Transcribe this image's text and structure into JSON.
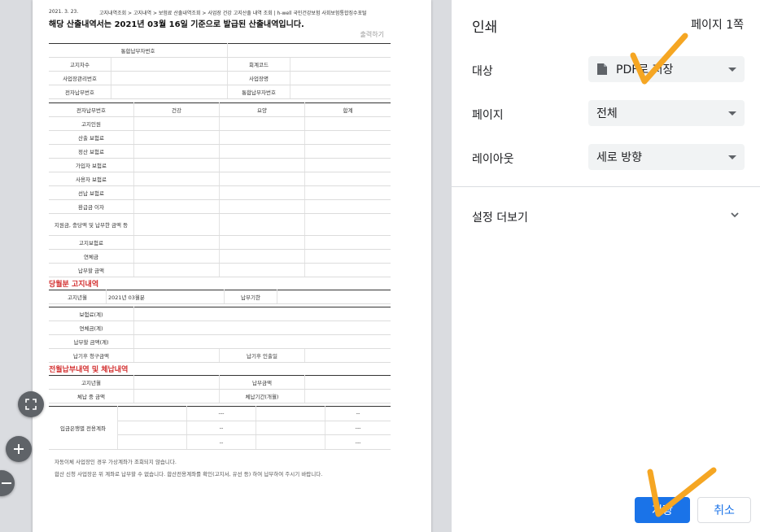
{
  "document": {
    "date": "2021. 3. 23.",
    "breadcrumb": "고지내역조회 > 고지내역 > 보험료 산출내역조회 > 사업장 건강 고지산출 내역 조회 | h-well 국민건강보험 사회보험통합징수포털",
    "headline": "해당 산출내역서는 2021년 03월 16일 기준으로 발급된 산출내역입니다.",
    "print_link": "출력하기",
    "info_rows": [
      [
        "통합납부자번호",
        "",
        "",
        ""
      ],
      [
        "고지차수",
        "",
        "회계코드",
        ""
      ],
      [
        "사업장관리번호",
        "",
        "사업장명",
        ""
      ],
      [
        "전자납부번호",
        "",
        "통합납부자번호",
        ""
      ]
    ],
    "calc_header": [
      "전자납부번호",
      "건강",
      "요양",
      "합계"
    ],
    "calc_rows": [
      "고지인원",
      "산출 보험료",
      "정산 보험료",
      "가입자 보험료",
      "사용자 보험료",
      "선납 보험료",
      "환급금 이자",
      "지원금, 충당액 및 납부한 금액 등",
      "고지보험료",
      "연체금",
      "납부할 금액"
    ],
    "section1_title": "당월분 고지내역",
    "section1": {
      "period_label": "고지년월",
      "period_value": "2021년 03월분",
      "due_label": "납부기한",
      "rows": [
        "보험료(계)",
        "연체금(계)",
        "납부할 금액(계)"
      ],
      "late_label": "납기후 청구금액",
      "late_date_label": "납기후 인출일"
    },
    "section2_title": "전월납부내역 및 체납내역",
    "section2": {
      "r1_left": "고지년월",
      "r1_right": "납부금액",
      "r2_left": "체납 중 금액",
      "r2_right": "체납기간(개월)"
    },
    "bank": {
      "label": "입금은행별 전용계좌",
      "dashes": [
        "---",
        "--",
        "--",
        "---",
        "--",
        "---"
      ]
    },
    "notes": [
      "자동이체 사업장인 경우 가상계좌가 조회되지 않습니다.",
      "합산 신청 사업장은 위 계좌로 납부할 수 없습니다. 합산전용계좌를 확인(고지서, 유선 등) 하여 납부하여 주시기 바랍니다."
    ]
  },
  "print_panel": {
    "title": "인쇄",
    "page_count": "페이지 1쪽",
    "destination_label": "대상",
    "destination_value": "PDF로 저장",
    "pages_label": "페이지",
    "pages_value": "전체",
    "layout_label": "레이아웃",
    "layout_value": "세로 방향",
    "more_settings": "설정 더보기",
    "save_button": "저장",
    "cancel_button": "취소"
  },
  "colors": {
    "accent": "#1a73e8",
    "section_red": "#d32f2f",
    "annotation_orange": "#f5a623"
  }
}
